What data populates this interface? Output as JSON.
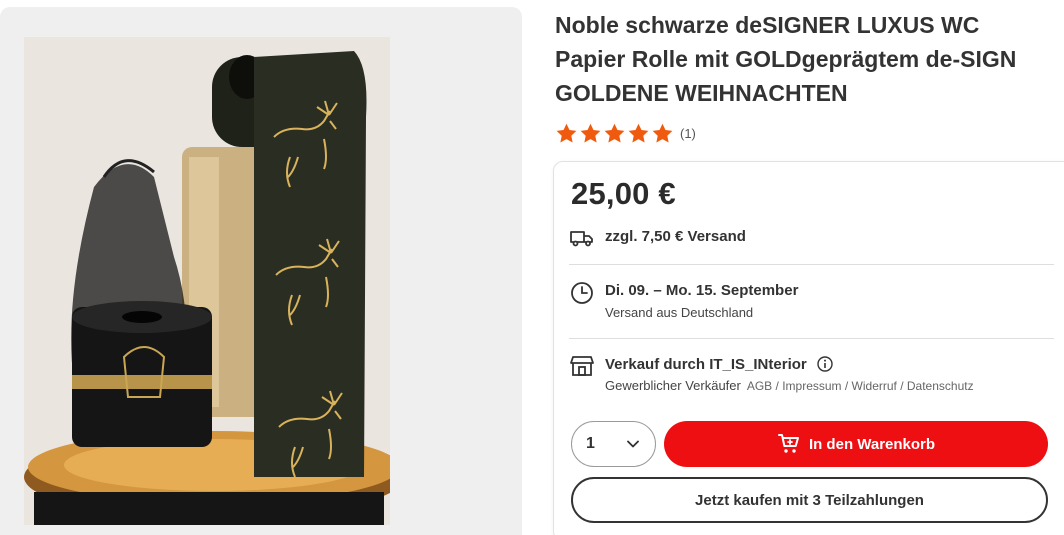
{
  "product": {
    "title": "Noble schwarze deSIGNER LUXUS WC Papier Rolle mit GOLDgeprägtem de-SIGN GOLDENE WEIHNACHTEN",
    "image_alt": "Schwarze Toilettenpapierrolle mit goldenen Hirschmotiven",
    "rating": {
      "stars": 5,
      "max": 5,
      "count_label": "(1)"
    },
    "price": "25,00 €"
  },
  "shipping": {
    "cost_label": "zzgl. 7,50 € Versand"
  },
  "delivery": {
    "date_label": "Di. 09. – Mo. 15. September",
    "origin_label": "Versand aus Deutschland"
  },
  "seller": {
    "label": "Verkauf durch IT_IS_INterior",
    "type_label": "Gewerblicher Verkäufer",
    "links_label": "AGB / Impressum / Widerruf / Datenschutz"
  },
  "purchase": {
    "quantity": "1",
    "cart_button_label": "In den Warenkorb",
    "installment_button_label": "Jetzt kaufen mit 3 Teilzahlungen"
  },
  "colors": {
    "accent_red": "#ee0f13",
    "star_orange": "#f05a0f"
  }
}
